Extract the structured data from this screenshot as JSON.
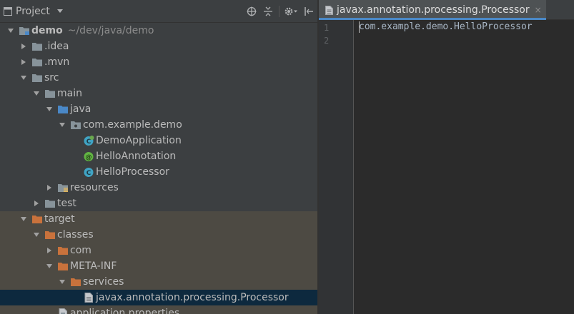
{
  "project_panel": {
    "title": "Project",
    "header_icons": [
      "scroll-from-source-icon",
      "collapse-all-icon",
      "gear-icon",
      "hide-icon"
    ]
  },
  "tree": [
    {
      "label": "demo",
      "path": "~/dev/java/demo",
      "bold": true,
      "depth": 0,
      "state": "expanded",
      "icon": "module-folder-icon"
    },
    {
      "label": ".idea",
      "depth": 1,
      "state": "collapsed",
      "icon": "folder-icon"
    },
    {
      "label": ".mvn",
      "depth": 1,
      "state": "collapsed",
      "icon": "folder-icon"
    },
    {
      "label": "src",
      "depth": 1,
      "state": "expanded",
      "icon": "folder-icon"
    },
    {
      "label": "main",
      "depth": 2,
      "state": "expanded",
      "icon": "folder-icon"
    },
    {
      "label": "java",
      "depth": 3,
      "state": "expanded",
      "icon": "source-folder-icon"
    },
    {
      "label": "com.example.demo",
      "depth": 4,
      "state": "expanded",
      "icon": "package-icon"
    },
    {
      "label": "DemoApplication",
      "depth": 5,
      "state": "leaf",
      "icon": "spring-class-icon"
    },
    {
      "label": "HelloAnnotation",
      "depth": 5,
      "state": "leaf",
      "icon": "annotation-icon"
    },
    {
      "label": "HelloProcessor",
      "depth": 5,
      "state": "leaf",
      "icon": "class-icon"
    },
    {
      "label": "resources",
      "depth": 3,
      "state": "collapsed",
      "icon": "resources-folder-icon"
    },
    {
      "label": "test",
      "depth": 2,
      "state": "collapsed",
      "icon": "folder-icon"
    },
    {
      "label": "target",
      "depth": 1,
      "state": "expanded",
      "icon": "excluded-folder-icon",
      "excluded": true
    },
    {
      "label": "classes",
      "depth": 2,
      "state": "expanded",
      "icon": "excluded-folder-icon",
      "excluded": true
    },
    {
      "label": "com",
      "depth": 3,
      "state": "collapsed",
      "icon": "excluded-folder-icon",
      "excluded": true
    },
    {
      "label": "META-INF",
      "depth": 3,
      "state": "expanded",
      "icon": "excluded-folder-icon",
      "excluded": true
    },
    {
      "label": "services",
      "depth": 4,
      "state": "expanded",
      "icon": "excluded-folder-icon",
      "excluded": true
    },
    {
      "label": "javax.annotation.processing.Processor",
      "depth": 5,
      "state": "leaf",
      "icon": "text-file-icon",
      "excluded": true,
      "selected": true
    },
    {
      "label": "application.properties",
      "depth": 3,
      "state": "leaf",
      "icon": "properties-file-icon",
      "excluded": true
    }
  ],
  "editor": {
    "tab": {
      "label": "javax.annotation.processing.Processor",
      "close_glyph": "×",
      "icon": "text-file-icon"
    },
    "line_numbers": [
      "1",
      "2"
    ],
    "lines": [
      "com.example.demo.HelloProcessor",
      ""
    ]
  },
  "colors": {
    "panel_bg": "#3c3f41",
    "editor_bg": "#2b2b2b",
    "excluded_row_bg": "#4d4a43",
    "selected_row_bg": "#0d293e",
    "excluded_folder": "#c9723c",
    "source_folder": "#4a88c7",
    "tab_accent": "#4a88c7"
  }
}
